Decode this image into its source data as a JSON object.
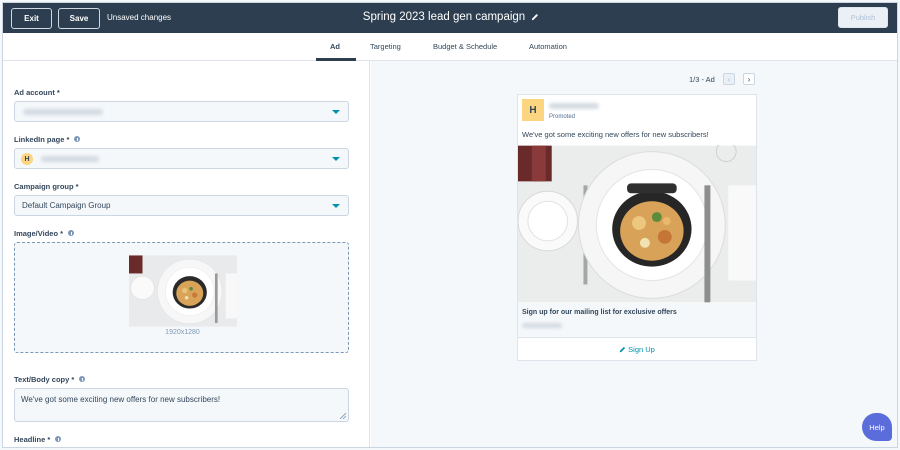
{
  "topbar": {
    "exit_label": "Exit",
    "save_label": "Save",
    "status": "Unsaved changes",
    "title": "Spring 2023 lead gen campaign",
    "publish_label": "Publish"
  },
  "tabs": [
    {
      "label": "Ad",
      "active": true
    },
    {
      "label": "Targeting",
      "active": false
    },
    {
      "label": "Budget & Schedule",
      "active": false
    },
    {
      "label": "Automation",
      "active": false
    }
  ],
  "form": {
    "ad_account_label": "Ad account *",
    "linkedin_page_label": "LinkedIn page *",
    "linkedin_page_avatar": "H",
    "campaign_group_label": "Campaign group *",
    "campaign_group_value": "Default Campaign Group",
    "image_video_label": "Image/Video *",
    "image_dimensions": "1920x1280",
    "body_copy_label": "Text/Body copy *",
    "body_copy_value": "We've got some exciting new offers for new subscribers!",
    "headline_label": "Headline *"
  },
  "preview": {
    "pager": "1/3 - Ad",
    "prev_icon": "chevron-left-icon",
    "next_icon": "chevron-right-icon",
    "logo_letter": "H",
    "promoted": "Promoted",
    "copy": "We've got some exciting new offers for new subscribers!",
    "headline": "Sign up for our mailing list for exclusive offers",
    "cta": "Sign Up"
  },
  "help_label": "Help",
  "colors": {
    "topbar": "#2d3e50",
    "accent": "#0091ae",
    "logo": "#fcd581",
    "help": "#5b6cdb"
  }
}
